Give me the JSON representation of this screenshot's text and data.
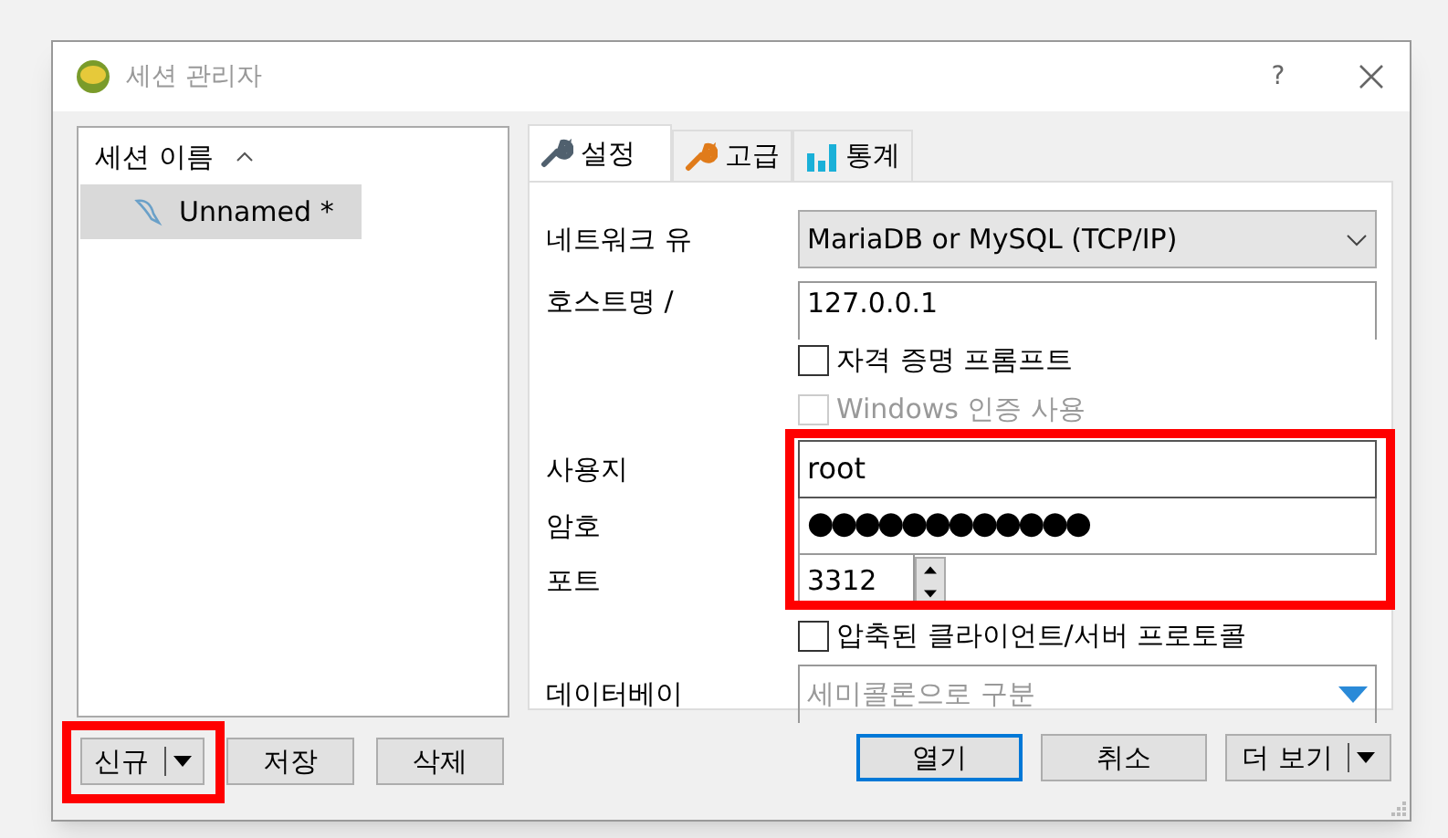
{
  "window": {
    "title": "세션 관리자",
    "help": "?"
  },
  "sessions": {
    "header": "세션 이름",
    "items": [
      {
        "name": "Unnamed *",
        "selected": true
      }
    ]
  },
  "tabs": [
    {
      "label": "설정",
      "selected": true
    },
    {
      "label": "고급",
      "selected": false
    },
    {
      "label": "통계",
      "selected": false
    }
  ],
  "settings": {
    "network_type": {
      "label": "네트워크 유",
      "value": "MariaDB or MySQL (TCP/IP)"
    },
    "hostname": {
      "label": "호스트명 /",
      "value": "127.0.0.1"
    },
    "credential_prompt": {
      "label": "자격 증명 프롬프트",
      "checked": false,
      "disabled": false
    },
    "windows_auth": {
      "label": "Windows 인증 사용",
      "checked": false,
      "disabled": true
    },
    "user": {
      "label": "사용지",
      "value": "root"
    },
    "password": {
      "label": "암호",
      "value": "●●●●●●●●●●●●"
    },
    "port": {
      "label": "포트",
      "value": "3312"
    },
    "compressed": {
      "label": "압축된 클라이언트/서버 프로토콜",
      "checked": false,
      "disabled": false
    },
    "databases": {
      "label": "데이터베이",
      "placeholder": "세미콜론으로 구분"
    }
  },
  "session_buttons": [
    {
      "label": "신규",
      "dropdown": true
    },
    {
      "label": "저장",
      "dropdown": false
    },
    {
      "label": "삭제",
      "dropdown": false
    }
  ],
  "dialog_buttons": [
    {
      "label": "열기",
      "default": true,
      "dropdown": false
    },
    {
      "label": "취소",
      "default": false,
      "dropdown": false
    },
    {
      "label": "더 보기",
      "default": false,
      "dropdown": true
    }
  ]
}
